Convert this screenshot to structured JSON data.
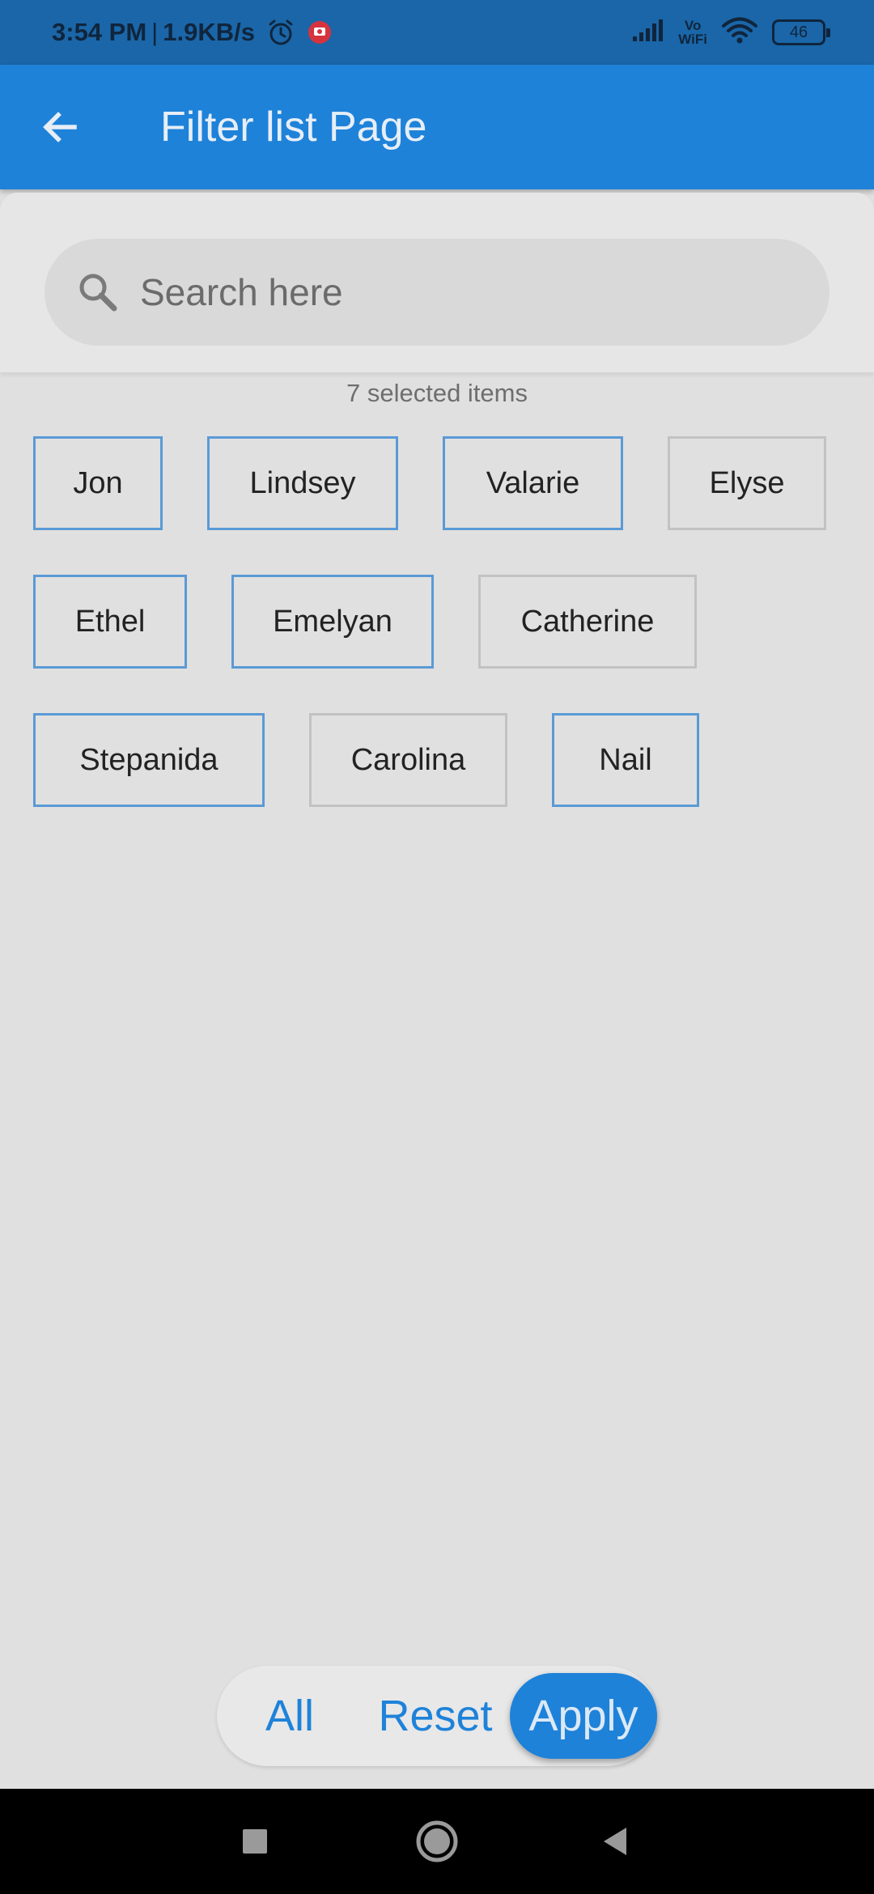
{
  "status_bar": {
    "time": "3:54 PM",
    "separator": "|",
    "network_speed": "1.9KB/s",
    "icons": [
      "alarm-icon",
      "screen-record-icon",
      "signal-icon",
      "wifi-icon"
    ],
    "vowifi_top": "Vo",
    "vowifi_bottom": "WiFi",
    "battery": "46"
  },
  "app_bar": {
    "back_icon": "arrow-left-icon",
    "title": "Filter list Page",
    "color": "#1e82d9"
  },
  "search": {
    "icon": "search-icon",
    "placeholder": "Search here",
    "value": ""
  },
  "selected_count_text": "7 selected items",
  "chips": [
    {
      "label": "Jon",
      "selected": true
    },
    {
      "label": "Lindsey",
      "selected": true
    },
    {
      "label": "Valarie",
      "selected": true
    },
    {
      "label": "Elyse",
      "selected": false
    },
    {
      "label": "Ethel",
      "selected": true
    },
    {
      "label": "Emelyan",
      "selected": true
    },
    {
      "label": "Catherine",
      "selected": false
    },
    {
      "label": "Stepanida",
      "selected": true
    },
    {
      "label": "Carolina",
      "selected": false
    },
    {
      "label": "Nail",
      "selected": true
    }
  ],
  "actions": {
    "all_label": "All",
    "reset_label": "Reset",
    "apply_label": "Apply"
  },
  "nav_bar": {
    "icons": [
      "recents-square-icon",
      "home-circle-icon",
      "back-triangle-icon"
    ]
  },
  "colors": {
    "accent": "#1e82d9",
    "selected_border": "#5a9ad6",
    "unselected_border": "#c2c2c2",
    "background": "#e0e0e0"
  }
}
